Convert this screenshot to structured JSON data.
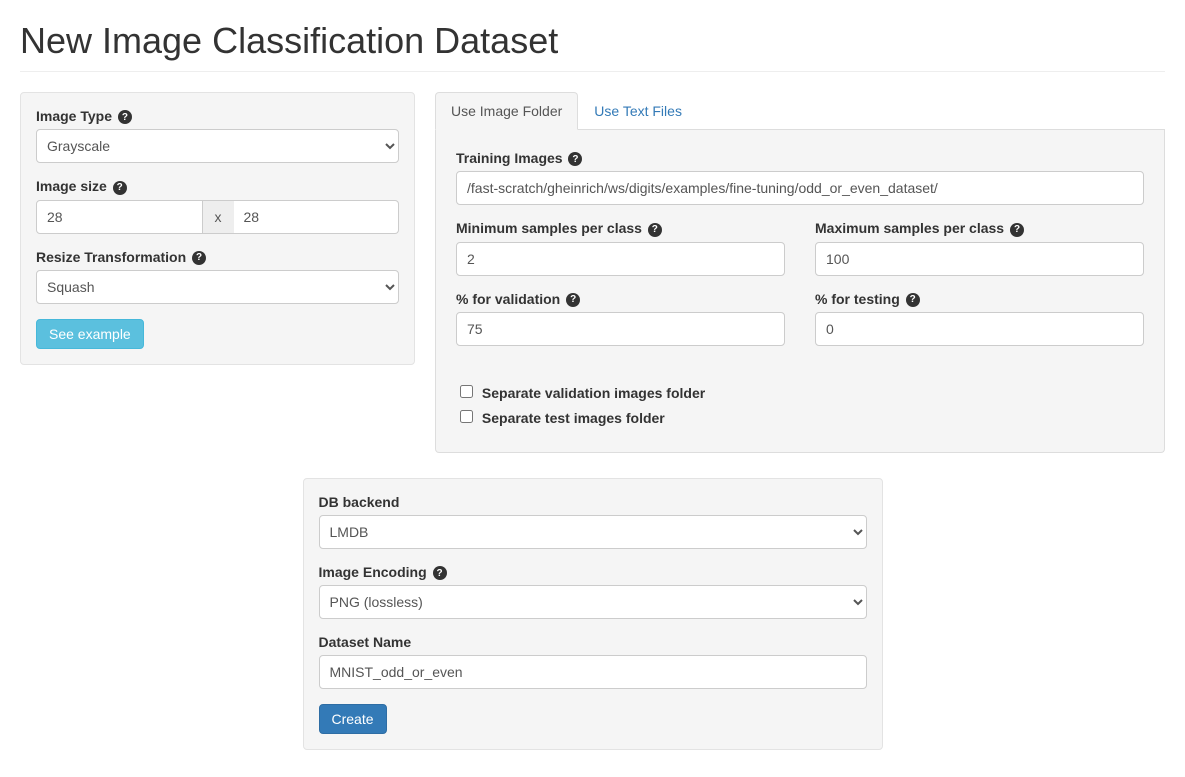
{
  "page_title": "New Image Classification Dataset",
  "left": {
    "image_type_label": "Image Type",
    "image_type_value": "Grayscale",
    "image_size_label": "Image size",
    "image_width": "28",
    "image_size_x": "x",
    "image_height": "28",
    "resize_label": "Resize Transformation",
    "resize_value": "Squash",
    "see_example_btn": "See example"
  },
  "tabs": {
    "t1": "Use Image Folder",
    "t2": "Use Text Files"
  },
  "folder": {
    "training_images_label": "Training Images",
    "training_images_value": "/fast-scratch/gheinrich/ws/digits/examples/fine-tuning/odd_or_even_dataset/",
    "min_samples_label": "Minimum samples per class",
    "min_samples_value": "2",
    "max_samples_label": "Maximum samples per class",
    "max_samples_value": "100",
    "pct_validation_label": "% for validation",
    "pct_validation_value": "75",
    "pct_testing_label": "% for testing",
    "pct_testing_value": "0",
    "sep_validation_label": "Separate validation images folder",
    "sep_test_label": "Separate test images folder"
  },
  "bottom": {
    "db_backend_label": "DB backend",
    "db_backend_value": "LMDB",
    "image_encoding_label": "Image Encoding",
    "image_encoding_value": "PNG (lossless)",
    "dataset_name_label": "Dataset Name",
    "dataset_name_value": "MNIST_odd_or_even",
    "create_btn": "Create"
  }
}
